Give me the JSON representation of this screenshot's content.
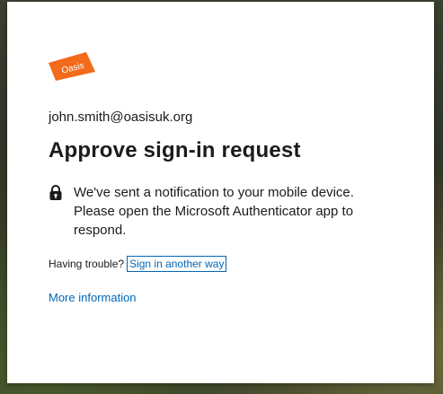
{
  "logo": {
    "text": "Oasis",
    "color": "#f26a1b"
  },
  "account": {
    "email": "john.smith@oasisuk.org"
  },
  "title": "Approve sign-in request",
  "notice": {
    "icon": "lock-icon",
    "text": "We've sent a notification to your mobile device. Please open the Microsoft Authenticator app to respond."
  },
  "trouble": {
    "prompt": "Having trouble?",
    "link": "Sign in another way"
  },
  "more_info": "More information",
  "colors": {
    "link": "#0067b8",
    "text": "#1b1b1b"
  }
}
